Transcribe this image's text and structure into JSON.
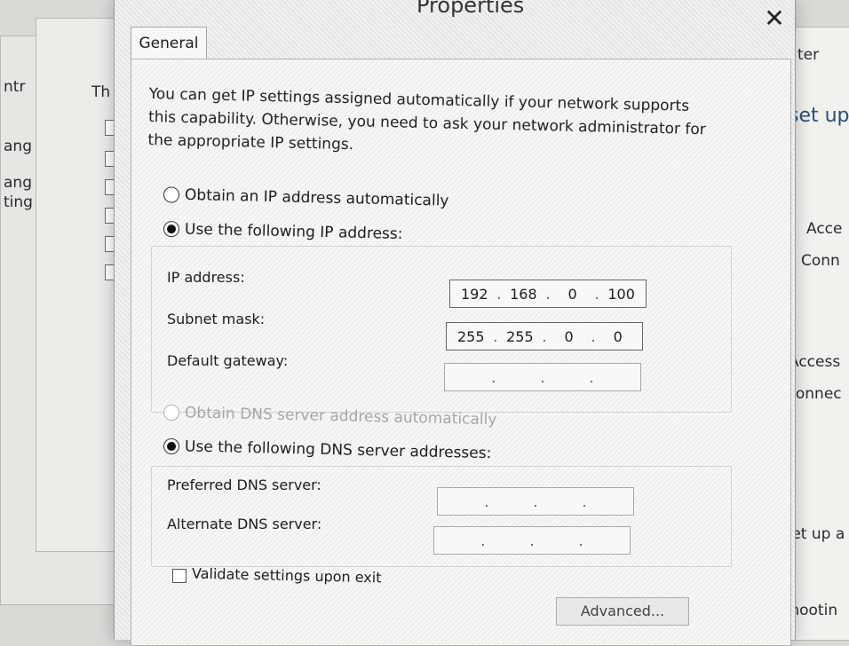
{
  "dialog": {
    "title_fragment": "Properties",
    "close_glyph": "✕",
    "tab_general": "General",
    "intro": "You can get IP settings assigned automatically if your network supports this capability. Otherwise, you need to ask your network administrator for the appropriate IP settings.",
    "ip_section": {
      "auto_label": "Obtain an IP address automatically",
      "manual_label": "Use the following IP address:",
      "manual_selected": true,
      "ip_address_label": "IP address:",
      "ip_address": [
        "192",
        "168",
        "0",
        "100"
      ],
      "subnet_label": "Subnet mask:",
      "subnet": [
        "255",
        "255",
        "0",
        "0"
      ],
      "gateway_label": "Default gateway:",
      "gateway": [
        "",
        "",
        "",
        ""
      ]
    },
    "dns_section": {
      "auto_label": "Obtain DNS server address automatically",
      "manual_label": "Use the following DNS server addresses:",
      "manual_selected": true,
      "preferred_label": "Preferred DNS server:",
      "preferred": [
        "",
        "",
        "",
        ""
      ],
      "alternate_label": "Alternate DNS server:",
      "alternate": [
        "",
        "",
        "",
        ""
      ]
    },
    "validate_label": "Validate settings upon exit",
    "validate_checked": false,
    "advanced_button": "Advanced..."
  },
  "background": {
    "left_fragments": [
      "ntr",
      "Th",
      "ang",
      "ang",
      "ting"
    ],
    "right_fragments": [
      "ter",
      "set up",
      "Acce",
      "Conn",
      "Access",
      "Connec",
      "tion; or set up a",
      "t troubleshootin"
    ]
  },
  "colors": {
    "dialog_bg": "#ececec",
    "panel_bg": "#f4f4f2",
    "border": "#a8a8a8",
    "text": "#222222",
    "disabled_text": "#a6a6a6"
  }
}
